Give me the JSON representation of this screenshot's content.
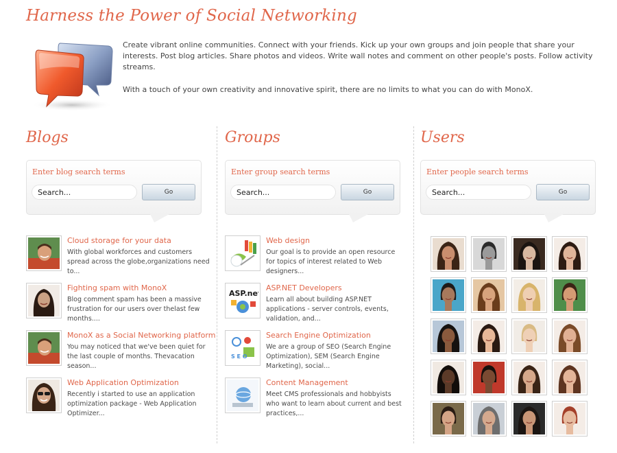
{
  "headline": "Harness the Power of Social Networking",
  "intro": {
    "paragraph1": "Create vibrant online communities. Connect with your friends. Kick up your own groups and join people that share your interests. Post blog articles. Share photos and videos. Write wall notes and comment on other people's posts. Follow activity streams.",
    "paragraph2": "With a touch of your own creativity and innovative spirit, there are no limits to what you can do with MonoX."
  },
  "blogs": {
    "title": "Blogs",
    "search_label": "Enter blog search terms",
    "search_placeholder": "Search...",
    "go_label": "Go",
    "items": [
      {
        "title": "Cloud storage for your data",
        "desc": "With global workforces and customers spread across the globe,organizations need to...",
        "thumb_icon": "man-portrait"
      },
      {
        "title": "Fighting spam with MonoX",
        "desc": "Blog comment spam has been a massive frustration for our users over thelast few months....",
        "thumb_icon": "woman-portrait"
      },
      {
        "title": "MonoX as a Social Networking platform",
        "desc": "You may noticed that we've been quiet for the last couple of months. Thevacation season...",
        "thumb_icon": "man-portrait"
      },
      {
        "title": "Web Application Optimization",
        "desc": "Recently i started to use an application optimization package - Web Application Optimizer...",
        "thumb_icon": "woman-sunglasses-portrait"
      }
    ]
  },
  "groups": {
    "title": "Groups",
    "search_label": "Enter group search terms",
    "search_placeholder": "Search...",
    "go_label": "Go",
    "items": [
      {
        "title": "Web design",
        "desc": "Our goal is to provide an open resource for topics of interest related to Web designers...",
        "thumb_icon": "web-design-icon"
      },
      {
        "title": "ASP.NET Developers",
        "desc": "Learn all about building ASP.NET applications - server controls, events, validation, and...",
        "thumb_icon": "aspnet-logo",
        "thumb_text": "ASP.net"
      },
      {
        "title": "Search Engine Optimization",
        "desc": "We are a group of SEO (Search Engine Optimization), SEM (Search Engine Marketing), social...",
        "thumb_icon": "seo-icon",
        "thumb_text": "S E O"
      },
      {
        "title": "Content Management",
        "desc": "Meet CMS professionals and hobbyists who want to learn about current and best practices,...",
        "thumb_icon": "cms-icon"
      }
    ]
  },
  "users": {
    "title": "Users",
    "search_label": "Enter people search terms",
    "search_placeholder": "Search...",
    "go_label": "Go",
    "avatars": [
      {
        "icon": "user-avatar",
        "skin": "#c98e6e",
        "hair": "#3b2416",
        "bg": "#e9dccf"
      },
      {
        "icon": "user-avatar",
        "skin": "#9a9a9a",
        "hair": "#2a2a2a",
        "bg": "#d8d8d8"
      },
      {
        "icon": "user-avatar",
        "skin": "#d8b8a0",
        "hair": "#1b1410",
        "bg": "#3a2a20"
      },
      {
        "icon": "user-avatar",
        "skin": "#e0b59a",
        "hair": "#2d1b12",
        "bg": "#f4ece6"
      },
      {
        "icon": "user-avatar",
        "skin": "#a7795c",
        "hair": "#1f1b19",
        "bg": "#4aa6c9"
      },
      {
        "icon": "user-avatar",
        "skin": "#d7a37d",
        "hair": "#6a3d1c",
        "bg": "#e5c7a3"
      },
      {
        "icon": "user-avatar",
        "skin": "#efcfb2",
        "hair": "#d8b46b",
        "bg": "#f3ede6"
      },
      {
        "icon": "user-avatar",
        "skin": "#d59b74",
        "hair": "#3b2415",
        "bg": "#4f8e4a"
      },
      {
        "icon": "user-avatar",
        "skin": "#8a5a3d",
        "hair": "#161210",
        "bg": "#b7c7d8"
      },
      {
        "icon": "user-avatar",
        "skin": "#e7b898",
        "hair": "#2a1a12",
        "bg": "#f4ece6"
      },
      {
        "icon": "user-avatar",
        "skin": "#efd0b6",
        "hair": "#d9bb84",
        "bg": "#f1ece6"
      },
      {
        "icon": "user-avatar",
        "skin": "#e1b093",
        "hair": "#7a4a28",
        "bg": "#f4ece6"
      },
      {
        "icon": "user-avatar",
        "skin": "#5b3a28",
        "hair": "#120d0a",
        "bg": "#f0e9e2"
      },
      {
        "icon": "user-avatar",
        "skin": "#7a4a32",
        "hair": "#17100c",
        "bg": "#c0392b"
      },
      {
        "icon": "user-avatar",
        "skin": "#d6a88a",
        "hair": "#3a2416",
        "bg": "#f4ece6"
      },
      {
        "icon": "user-avatar",
        "skin": "#e4b599",
        "hair": "#5e3420",
        "bg": "#f4ece6"
      },
      {
        "icon": "user-avatar",
        "skin": "#d4a486",
        "hair": "#2a1c14",
        "bg": "#7a6a4a"
      },
      {
        "icon": "user-avatar",
        "skin": "#d4a98e",
        "hair": "#6e6e6e",
        "bg": "#c9cfd6"
      },
      {
        "icon": "user-avatar",
        "skin": "#c99677",
        "hair": "#1b1512",
        "bg": "#2a2a2a"
      },
      {
        "icon": "user-avatar",
        "skin": "#e7bca0",
        "hair": "#a4402a",
        "bg": "#f4ece6"
      }
    ]
  },
  "colors": {
    "accent": "#e0664a",
    "text": "#4a4a4a"
  }
}
